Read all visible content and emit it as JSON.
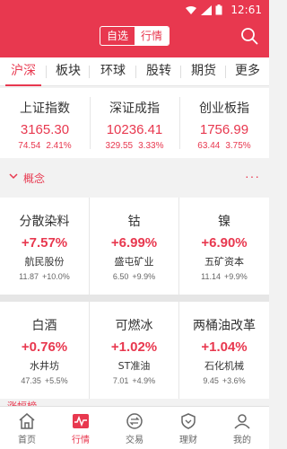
{
  "status_bar": {
    "time": "12:61"
  },
  "header": {
    "toggle": [
      "自选",
      "行情"
    ],
    "active_toggle": 1
  },
  "market_tabs": [
    "沪深",
    "板块",
    "环球",
    "股转",
    "期货",
    "更多"
  ],
  "indices": [
    {
      "name": "上证指数",
      "value": "3165.30",
      "change": "74.54",
      "percent": "2.41%"
    },
    {
      "name": "深证成指",
      "value": "10236.41",
      "change": "329.55",
      "percent": "3.33%"
    },
    {
      "name": "创业板指",
      "value": "1756.99",
      "change": "63.44",
      "percent": "3.75%"
    }
  ],
  "section": {
    "title": "概念",
    "more": "···"
  },
  "concepts": [
    {
      "name": "分散染料",
      "percent": "+7.57%",
      "stock": "航民股份",
      "price": "11.87",
      "stock_change": "+10.0%"
    },
    {
      "name": "钴",
      "percent": "+6.99%",
      "stock": "盛屯矿业",
      "price": "6.50",
      "stock_change": "+9.9%"
    },
    {
      "name": "镍",
      "percent": "+6.90%",
      "stock": "五矿资本",
      "price": "11.14",
      "stock_change": "+9.9%"
    },
    {
      "name": "白酒",
      "percent": "+0.76%",
      "stock": "水井坊",
      "price": "47.35",
      "stock_change": "+5.5%"
    },
    {
      "name": "可燃冰",
      "percent": "+1.02%",
      "stock": "ST准油",
      "price": "7.01",
      "stock_change": "+4.9%"
    },
    {
      "name": "两桶油改革",
      "percent": "+1.04%",
      "stock": "石化机械",
      "price": "9.45",
      "stock_change": "+3.6%"
    }
  ],
  "next_section": {
    "title": "涨幅榜"
  },
  "bottom_nav": [
    {
      "label": "首页",
      "icon": "home-icon"
    },
    {
      "label": "行情",
      "icon": "market-chart-icon"
    },
    {
      "label": "交易",
      "icon": "trade-exchange-icon"
    },
    {
      "label": "理财",
      "icon": "wealth-shield-icon"
    },
    {
      "label": "我的",
      "icon": "profile-icon"
    }
  ],
  "colors": {
    "brand": "#e8384f",
    "text": "#333333",
    "muted": "#666666",
    "background": "#f2f2f2"
  }
}
